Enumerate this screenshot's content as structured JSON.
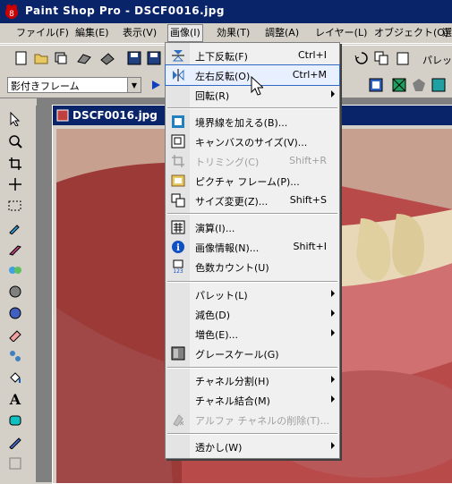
{
  "window": {
    "title": "Paint Shop Pro - DSCF0016.jpg"
  },
  "menubar": [
    {
      "label": "ファイル(F)",
      "active": false
    },
    {
      "label": "編集(E)",
      "active": false
    },
    {
      "label": "表示(V)",
      "active": false
    },
    {
      "label": "画像(I)",
      "active": true
    },
    {
      "label": "効果(T)",
      "active": false
    },
    {
      "label": "調整(A)",
      "active": false
    },
    {
      "label": "レイヤー(L)",
      "active": false
    },
    {
      "label": "オブジェクト(O)",
      "active": false
    },
    {
      "label": "選",
      "active": false
    }
  ],
  "toolbar": {
    "palette_label": "パレット",
    "frame_combo": "影付きフレーム"
  },
  "document": {
    "tab_title": "DSCF0016.jpg"
  },
  "image_menu": {
    "items": [
      {
        "label": "上下反転(F)",
        "shortcut": "Ctrl+I",
        "icon": "flip-vertical-icon",
        "state": "normal"
      },
      {
        "label": "左右反転(O)",
        "shortcut": "Ctrl+M",
        "icon": "flip-horizontal-icon",
        "state": "highlighted"
      },
      {
        "label": "回転(R)",
        "shortcut": "",
        "icon": "",
        "state": "submenu"
      },
      {
        "label": "境界線を加える(B)...",
        "shortcut": "",
        "icon": "add-border-icon",
        "state": "normal"
      },
      {
        "label": "キャンバスのサイズ(V)...",
        "shortcut": "",
        "icon": "canvas-size-icon",
        "state": "normal"
      },
      {
        "label": "トリミング(C)",
        "shortcut": "Shift+R",
        "icon": "crop-icon",
        "state": "disabled"
      },
      {
        "label": "ピクチャ フレーム(P)...",
        "shortcut": "",
        "icon": "picture-frame-icon",
        "state": "normal"
      },
      {
        "label": "サイズ変更(Z)...",
        "shortcut": "Shift+S",
        "icon": "resize-icon",
        "state": "normal"
      },
      {
        "label": "演算(I)...",
        "shortcut": "",
        "icon": "arithmetic-icon",
        "state": "normal"
      },
      {
        "label": "画像情報(N)...",
        "shortcut": "Shift+I",
        "icon": "image-info-icon",
        "state": "normal"
      },
      {
        "label": "色数カウント(U)",
        "shortcut": "",
        "icon": "count-colors-icon",
        "state": "normal"
      },
      {
        "label": "パレット(L)",
        "shortcut": "",
        "icon": "",
        "state": "submenu"
      },
      {
        "label": "減色(D)",
        "shortcut": "",
        "icon": "",
        "state": "submenu"
      },
      {
        "label": "増色(E)...",
        "shortcut": "",
        "icon": "",
        "state": "submenu"
      },
      {
        "label": "グレースケール(G)",
        "shortcut": "",
        "icon": "greyscale-icon",
        "state": "normal"
      },
      {
        "label": "チャネル分割(H)",
        "shortcut": "",
        "icon": "",
        "state": "submenu"
      },
      {
        "label": "チャネル結合(M)",
        "shortcut": "",
        "icon": "",
        "state": "submenu"
      },
      {
        "label": "アルファ チャネルの削除(T)...",
        "shortcut": "",
        "icon": "delete-alpha-icon",
        "state": "disabled"
      },
      {
        "label": "透かし(W)",
        "shortcut": "",
        "icon": "",
        "state": "submenu"
      }
    ]
  },
  "colors": {
    "titlebar": "#0a246a",
    "chrome": "#d4d0c8",
    "highlight": "#316ac5"
  }
}
